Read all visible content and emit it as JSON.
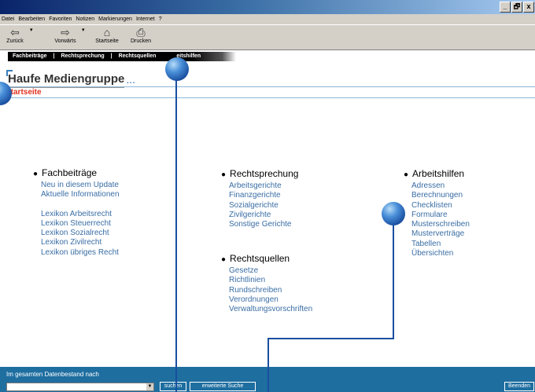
{
  "menu": [
    "Datei",
    "Bearbeiten",
    "Favoriten",
    "Notizen",
    "Markierungen",
    "Internet",
    "?"
  ],
  "window_controls": [
    "_",
    "🗗",
    "x"
  ],
  "toolbar": {
    "back": "Zurück",
    "forward": "Vorwärts",
    "home": "Startseite",
    "print": "Drucken"
  },
  "nav": {
    "fachbeitraege": "Fachbeiträge",
    "rechtsprechung": "Rechtsprechung",
    "rechtsquellen": "Rechtsquellen",
    "arbeitshilfen": "eitshilfen",
    "separator": "|"
  },
  "logo": {
    "text": "Haufe Mediengruppe",
    "dots": "..."
  },
  "startseite": "Startseite",
  "sections": {
    "fachbeitraege": {
      "title": "Fachbeiträge",
      "group1": [
        "Neu in diesem Update",
        "Aktuelle Informationen"
      ],
      "group2": [
        "Lexikon Arbeitsrecht",
        "Lexikon Steuerrecht",
        "Lexikon Sozialrecht",
        "Lexikon Zivilrecht",
        "Lexikon übriges Recht"
      ]
    },
    "rechtsprechung": {
      "title": "Rechtsprechung",
      "items": [
        "Arbeitsgerichte",
        "Finanzgerichte",
        "Sozialgerichte",
        "Zivilgerichte",
        "Sonstige Gerichte"
      ]
    },
    "rechtsquellen": {
      "title": "Rechtsquellen",
      "items": [
        "Gesetze",
        "Richtlinien",
        "Rundschreiben",
        "Verordnungen",
        "Verwaltungsvorschriften"
      ]
    },
    "arbeitshilfen": {
      "title": "Arbeitshilfen",
      "items": [
        "Adressen",
        "Berechnungen",
        "Checklisten",
        "Formulare",
        "Musterschreiben",
        "Musterverträge",
        "Tabellen",
        "Übersichten"
      ]
    }
  },
  "search": {
    "label": "Im gesamten Datenbestand nach",
    "suchen": "suchen",
    "erweiterte": "erweiterte Suche",
    "beenden": "Beenden"
  },
  "colors": {
    "accent": "#3a6ea5",
    "status_bar": "#1e6ea0",
    "highlight_red": "#e0321e"
  }
}
